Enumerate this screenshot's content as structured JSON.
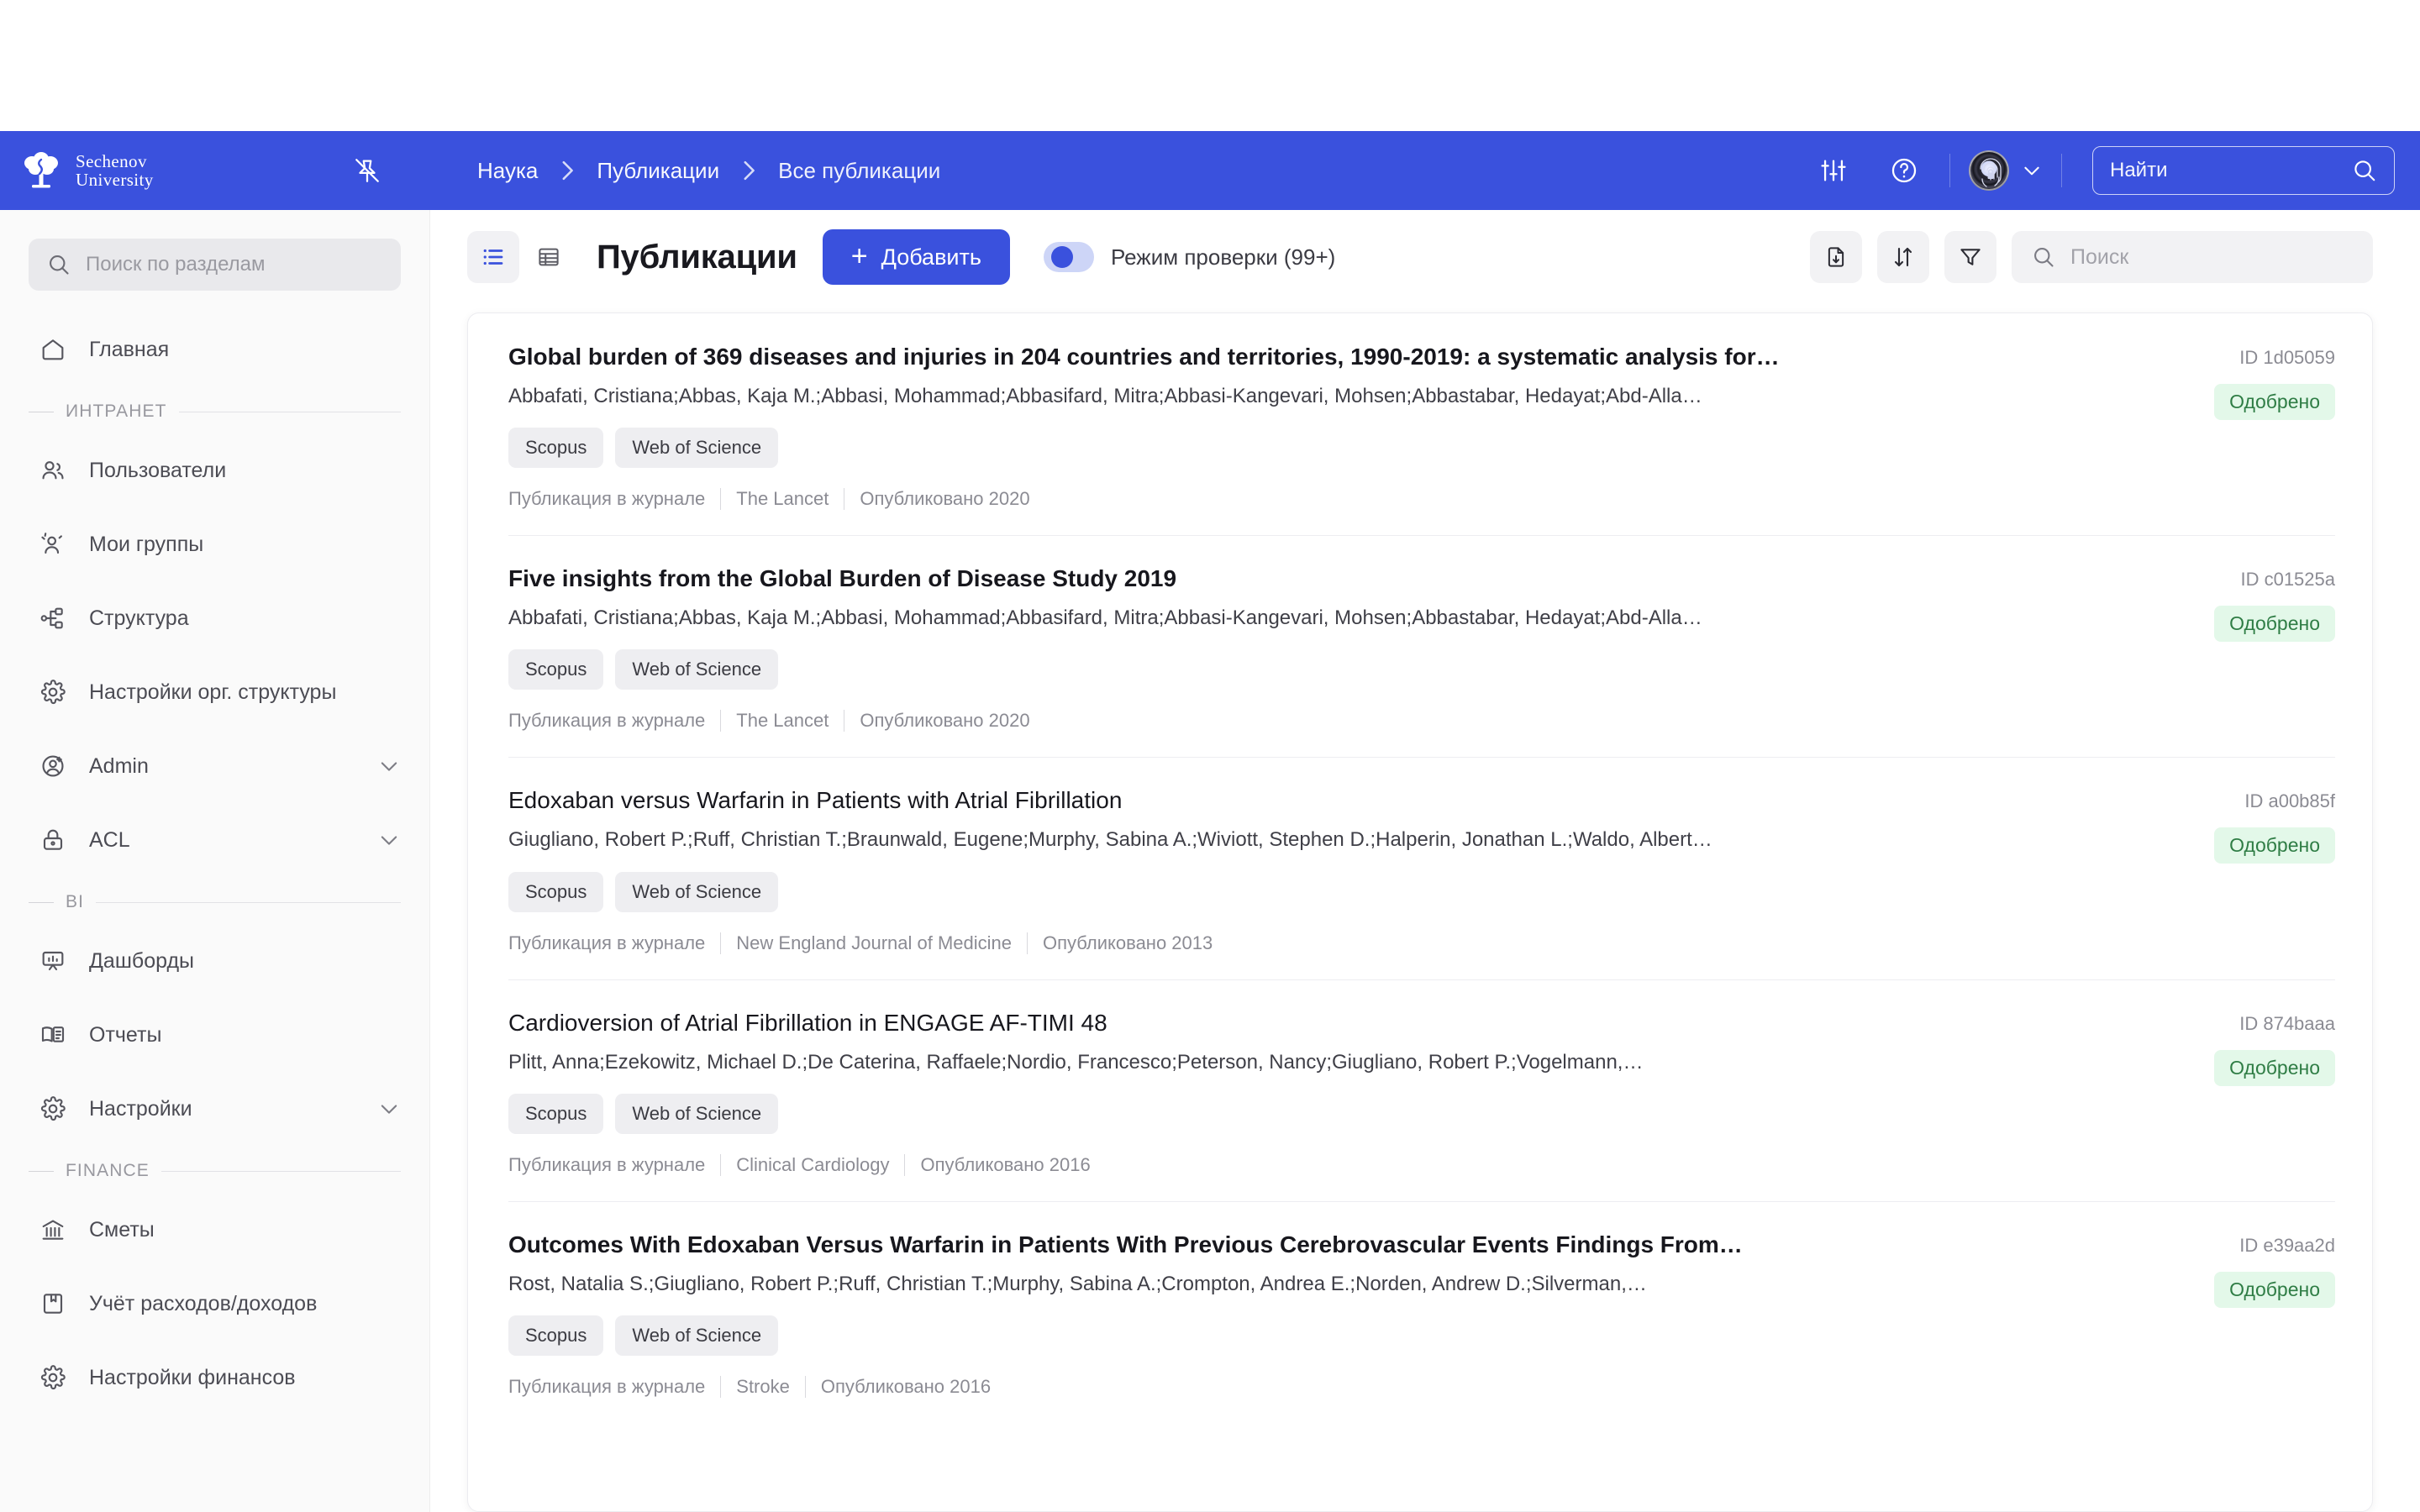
{
  "header": {
    "brand_line1": "Sechenov",
    "brand_line2": "University",
    "pin_icon": "pin-off-icon",
    "breadcrumb": [
      "Наука",
      "Публикации",
      "Все публикации"
    ],
    "sliders_icon": "sliders-icon",
    "help_icon": "help-circle-icon",
    "avatar_icon": "fingerprint-avatar",
    "chevron_icon": "chevron-down-icon",
    "search": {
      "placeholder": "Найти",
      "value": "",
      "icon": "search-icon"
    },
    "background_color": "#3a51dd"
  },
  "sidebar": {
    "search": {
      "placeholder": "Поиск по разделам",
      "value": "",
      "icon": "search-icon"
    },
    "groups": [
      {
        "title": null,
        "items": [
          {
            "label": "Главная",
            "icon": "home-icon",
            "expandable": false
          }
        ]
      },
      {
        "title": "ИНТРАНЕТ",
        "items": [
          {
            "label": "Пользователи",
            "icon": "users-icon",
            "expandable": false
          },
          {
            "label": "Мои группы",
            "icon": "user-group-icon",
            "expandable": false
          },
          {
            "label": "Структура",
            "icon": "sitemap-icon",
            "expandable": false
          },
          {
            "label": "Настройки орг. структуры",
            "icon": "gear-icon",
            "expandable": false
          },
          {
            "label": "Admin",
            "icon": "user-star-icon",
            "expandable": true
          },
          {
            "label": "ACL",
            "icon": "lock-icon",
            "expandable": true
          }
        ]
      },
      {
        "title": "BI",
        "items": [
          {
            "label": "Дашборды",
            "icon": "presentation-chart-icon",
            "expandable": false
          },
          {
            "label": "Отчеты",
            "icon": "book-open-icon",
            "expandable": false
          },
          {
            "label": "Настройки",
            "icon": "gear-icon",
            "expandable": true
          }
        ]
      },
      {
        "title": "FINANCE",
        "items": [
          {
            "label": "Сметы",
            "icon": "bank-icon",
            "expandable": false
          },
          {
            "label": "Учёт расходов/доходов",
            "icon": "ledger-book-icon",
            "expandable": false
          },
          {
            "label": "Настройки финансов",
            "icon": "gear-icon",
            "expandable": false
          }
        ]
      }
    ]
  },
  "toolbar": {
    "view_list_icon": "list-view-icon",
    "view_table_icon": "table-view-icon",
    "active_view": "list",
    "title": "Публикации",
    "add_label": "Добавить",
    "add_plus": "+",
    "check_mode_label": "Режим проверки (99+)",
    "check_mode_on": true,
    "export_icon": "file-download-icon",
    "sort_icon": "sort-arrows-icon",
    "filter_icon": "filter-funnel-icon",
    "search": {
      "placeholder": "Поиск",
      "value": "",
      "icon": "search-icon"
    },
    "accent_color": "#3a51dd"
  },
  "publications": [
    {
      "title": "Global burden of 369 diseases and injuries in 204 countries and territories, 1990-2019: a systematic analysis for…",
      "bold": true,
      "authors": "Abbafati, Cristiana;Abbas, Kaja M.;Abbasi, Mohammad;Abbasifard, Mitra;Abbasi-Kangevari, Mohsen;Abbastabar, Hedayat;Abd-Alla…",
      "tags": [
        "Scopus",
        "Web of Science"
      ],
      "type": "Публикация в журнале",
      "journal": "The Lancet",
      "published": "Опубликовано 2020",
      "id": "ID 1d05059",
      "status": "Одобрено",
      "status_color": "#2f7d45",
      "status_bg": "#e3f8e9"
    },
    {
      "title": "Five insights from the Global Burden of Disease Study 2019",
      "bold": true,
      "authors": "Abbafati, Cristiana;Abbas, Kaja M.;Abbasi, Mohammad;Abbasifard, Mitra;Abbasi-Kangevari, Mohsen;Abbastabar, Hedayat;Abd-Alla…",
      "tags": [
        "Scopus",
        "Web of Science"
      ],
      "type": "Публикация в журнале",
      "journal": "The Lancet",
      "published": "Опубликовано 2020",
      "id": "ID c01525a",
      "status": "Одобрено",
      "status_color": "#2f7d45",
      "status_bg": "#e3f8e9"
    },
    {
      "title": "Edoxaban versus Warfarin in Patients with Atrial Fibrillation",
      "bold": false,
      "authors": "Giugliano, Robert P.;Ruff, Christian T.;Braunwald, Eugene;Murphy, Sabina A.;Wiviott, Stephen D.;Halperin, Jonathan L.;Waldo, Albert…",
      "tags": [
        "Scopus",
        "Web of Science"
      ],
      "type": "Публикация в журнале",
      "journal": "New England Journal of Medicine",
      "published": "Опубликовано 2013",
      "id": "ID a00b85f",
      "status": "Одобрено",
      "status_color": "#2f7d45",
      "status_bg": "#e3f8e9"
    },
    {
      "title": "Cardioversion of Atrial Fibrillation in ENGAGE AF-TIMI 48",
      "bold": false,
      "authors": "Plitt, Anna;Ezekowitz, Michael D.;De Caterina, Raffaele;Nordio, Francesco;Peterson, Nancy;Giugliano, Robert P.;Vogelmann,…",
      "tags": [
        "Scopus",
        "Web of Science"
      ],
      "type": "Публикация в журнале",
      "journal": "Clinical Cardiology",
      "published": "Опубликовано 2016",
      "id": "ID 874baaa",
      "status": "Одобрено",
      "status_color": "#2f7d45",
      "status_bg": "#e3f8e9"
    },
    {
      "title": "Outcomes With Edoxaban Versus Warfarin in Patients With Previous Cerebrovascular Events Findings From…",
      "bold": true,
      "authors": "Rost, Natalia S.;Giugliano, Robert P.;Ruff, Christian T.;Murphy, Sabina A.;Crompton, Andrea E.;Norden, Andrew D.;Silverman,…",
      "tags": [
        "Scopus",
        "Web of Science"
      ],
      "type": "Публикация в журнале",
      "journal": "Stroke",
      "published": "Опубликовано 2016",
      "id": "ID e39aa2d",
      "status": "Одобрено",
      "status_color": "#2f7d45",
      "status_bg": "#e3f8e9"
    }
  ]
}
